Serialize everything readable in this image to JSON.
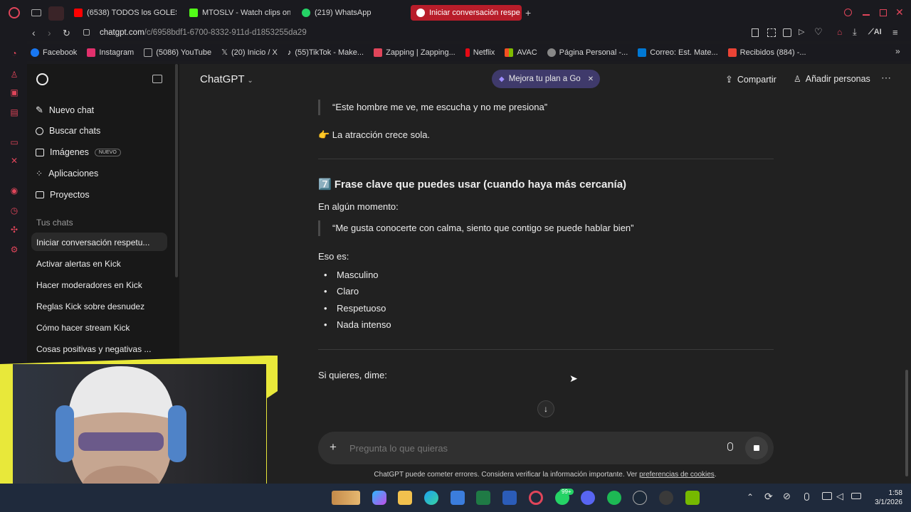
{
  "browser": {
    "tabs": [
      {
        "label": "(6538) TODOS los GOLES",
        "color": "#ff0000"
      },
      {
        "label": "MTOSLV - Watch clips on",
        "color": "#53fc18"
      },
      {
        "label": "(219) WhatsApp",
        "color": "#25d366"
      },
      {
        "label": "Iniciar conversación respe",
        "color": "#ffffff"
      }
    ],
    "url_host": "chatgpt.com",
    "url_path": "/c/6958bdf1-6700-8332-911d-d1853255da29",
    "ai_label": "AI",
    "bookmarks": [
      {
        "label": "Facebook",
        "color": "#1877f2"
      },
      {
        "label": "Instagram",
        "color": "#e1306c"
      },
      {
        "label": "(5086) YouTube",
        "color": "#888888"
      },
      {
        "label": "(20) Inicio / X",
        "color": "#cccccc"
      },
      {
        "label": "(55)TikTok - Make...",
        "color": "#ffffff"
      },
      {
        "label": "Zapping | Zapping...",
        "color": "#e0455a"
      },
      {
        "label": "Netflix",
        "color": "#e50914"
      },
      {
        "label": "AVAC",
        "color": "#f4b400"
      },
      {
        "label": "Página Personal -...",
        "color": "#aaaaaa"
      },
      {
        "label": "Correo: Est. Mate...",
        "color": "#0078d4"
      },
      {
        "label": "Recibidos (884) -...",
        "color": "#ea4335"
      }
    ]
  },
  "sidebar": {
    "nav": [
      {
        "label": "Nuevo chat",
        "icon": "edit-icon"
      },
      {
        "label": "Buscar chats",
        "icon": "search-icon"
      },
      {
        "label": "Imágenes",
        "icon": "image-icon",
        "badge": "NUEVO"
      },
      {
        "label": "Aplicaciones",
        "icon": "apps-icon"
      },
      {
        "label": "Proyectos",
        "icon": "folder-icon"
      }
    ],
    "section_title": "Tus chats",
    "chats": [
      "Iniciar conversación respetu...",
      "Activar alertas en Kick",
      "Hacer moderadores en Kick",
      "Reglas Kick sobre desnudez",
      "Cómo hacer stream Kick",
      "Cosas positivas y negativas ..."
    ]
  },
  "header": {
    "model": "ChatGPT",
    "upgrade": "Mejora tu plan a Go",
    "share": "Compartir",
    "add_people": "Añadir personas"
  },
  "conversation": {
    "quote1": "“Este hombre me ve, me escucha y no me presiona”",
    "line1": "👉 La atracción crece sola.",
    "heading": "7️⃣ Frase clave que puedes usar (cuando haya más cercanía)",
    "moment": "En algún momento:",
    "quote2": "“Me gusta conocerte con calma, siento que contigo se puede hablar bien”",
    "eso": "Eso es:",
    "bullets": [
      "Masculino",
      "Claro",
      "Respetuoso",
      "Nada intenso"
    ],
    "closing": "Si quieres, dime:"
  },
  "composer": {
    "placeholder": "Pregunta lo que quieras"
  },
  "footer": {
    "disclaimer": "ChatGPT puede cometer errores. Considera verificar la información importante. Ver",
    "link": "preferencias de cookies",
    "end": "."
  },
  "taskbar": {
    "time": "1:58",
    "date": "3/1/2026",
    "badge": "99+"
  },
  "colors": {
    "accent_red": "#b81d2a",
    "upgrade_bg": "#3f3a6b",
    "sidebar_bg": "#181818",
    "main_bg": "#212121"
  }
}
